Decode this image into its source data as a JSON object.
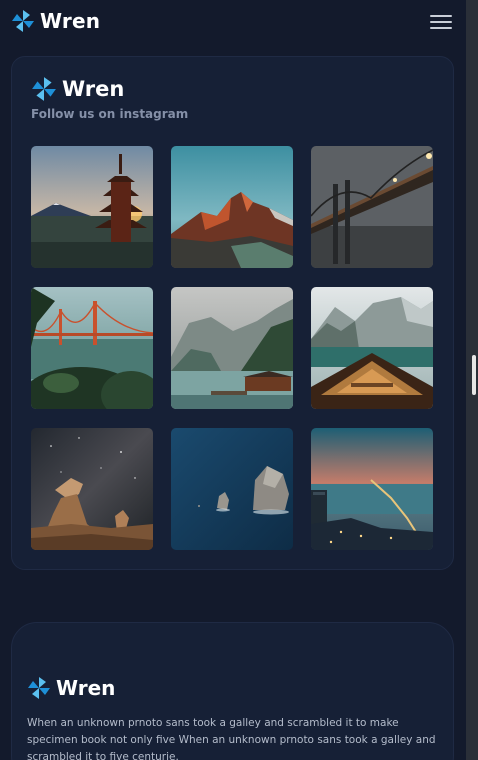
{
  "header": {
    "brand": "Wren",
    "logo_icon": "pinwheel-logo-icon",
    "menu_icon": "hamburger-menu-icon"
  },
  "instagram": {
    "brand": "Wren",
    "subtitle": "Follow us on instagram",
    "photos": [
      {
        "subject": "pagoda with Mount Fuji at sunset"
      },
      {
        "subject": "mountain peaks at sunrise"
      },
      {
        "subject": "suspension bridge in fog"
      },
      {
        "subject": "Golden Gate Bridge with foliage"
      },
      {
        "subject": "lake with boathouse and mountains"
      },
      {
        "subject": "wooden boat on alpine lake"
      },
      {
        "subject": "rock formations under milky way"
      },
      {
        "subject": "sea stacks in blue ocean"
      },
      {
        "subject": "city bay bridge at dusk"
      }
    ]
  },
  "about": {
    "brand": "Wren",
    "text": "When an unknown prnoto sans took a galley and scrambled it to make specimen book not only five When an unknown prnoto sans took a galley and scrambled it to five centurie."
  },
  "colors": {
    "background": "#131a2c",
    "card": "#162036",
    "logo_blue": "#1e90d8",
    "logo_light": "#5bc0f0"
  }
}
